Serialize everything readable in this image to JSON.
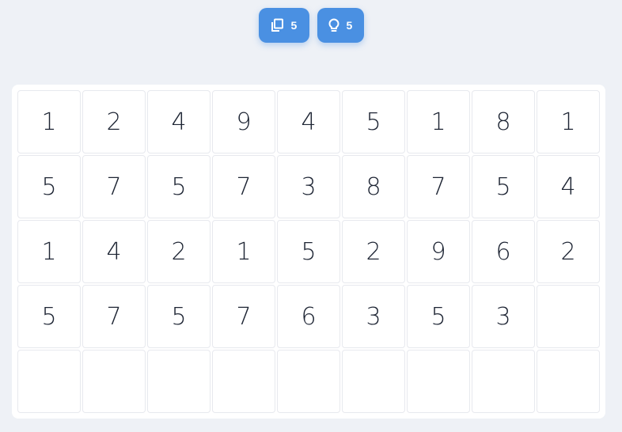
{
  "toolbar": {
    "copy_button": {
      "icon": "copy-icon",
      "count": "5"
    },
    "hint_button": {
      "icon": "lightbulb-icon",
      "count": "5"
    },
    "accent_color": "#4a90e2"
  },
  "board": {
    "rows": [
      [
        "1",
        "2",
        "4",
        "9",
        "4",
        "5",
        "1",
        "8",
        "1"
      ],
      [
        "5",
        "7",
        "5",
        "7",
        "3",
        "8",
        "7",
        "5",
        "4"
      ],
      [
        "1",
        "4",
        "2",
        "1",
        "5",
        "2",
        "9",
        "6",
        "2"
      ],
      [
        "5",
        "7",
        "5",
        "7",
        "6",
        "3",
        "5",
        "3",
        ""
      ],
      [
        "",
        "",
        "",
        "",
        "",
        "",
        "",
        "",
        ""
      ]
    ]
  }
}
